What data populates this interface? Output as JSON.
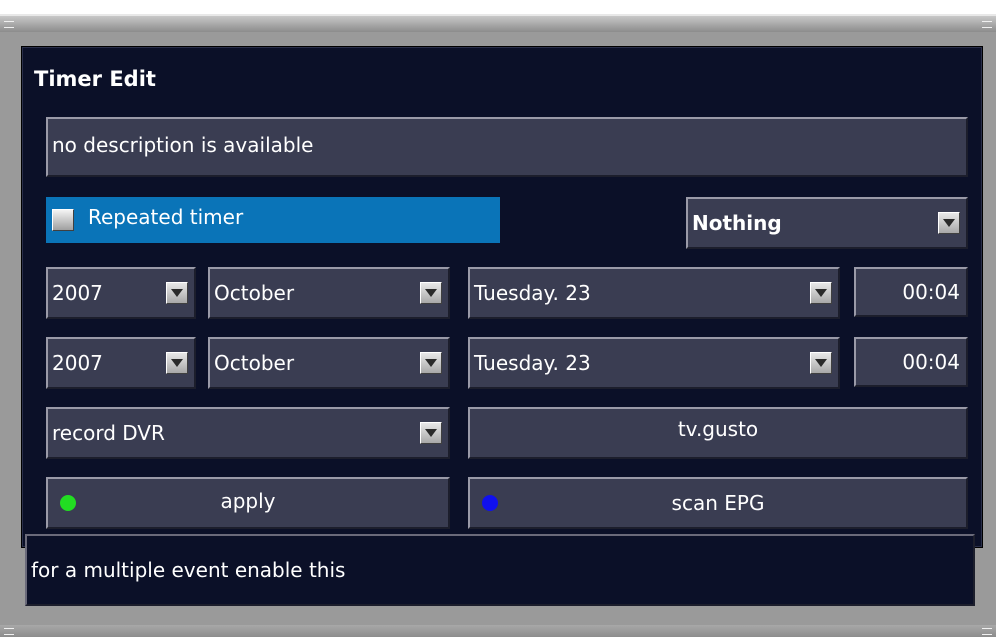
{
  "dialog": {
    "title": "Timer Edit",
    "description": "no description is available",
    "repeated_timer_label": "Repeated timer",
    "repeated_timer_checked": false,
    "after_event_value": "Nothing",
    "start": {
      "year": "2007",
      "month": "October",
      "day": "Tuesday. 23",
      "time": "00:04"
    },
    "end": {
      "year": "2007",
      "month": "October",
      "day": "Tuesday. 23",
      "time": "00:04"
    },
    "action_value": "record DVR",
    "channel": "tv.gusto",
    "buttons": {
      "apply": {
        "label": "apply",
        "dot_color": "#22dd22"
      },
      "scan": {
        "label": "scan EPG",
        "dot_color": "#1010ee"
      }
    },
    "status_text": "for a multiple event enable this"
  },
  "colors": {
    "background": "#0b1028",
    "field": "#3a3d52",
    "highlight": "#0a74b8"
  }
}
